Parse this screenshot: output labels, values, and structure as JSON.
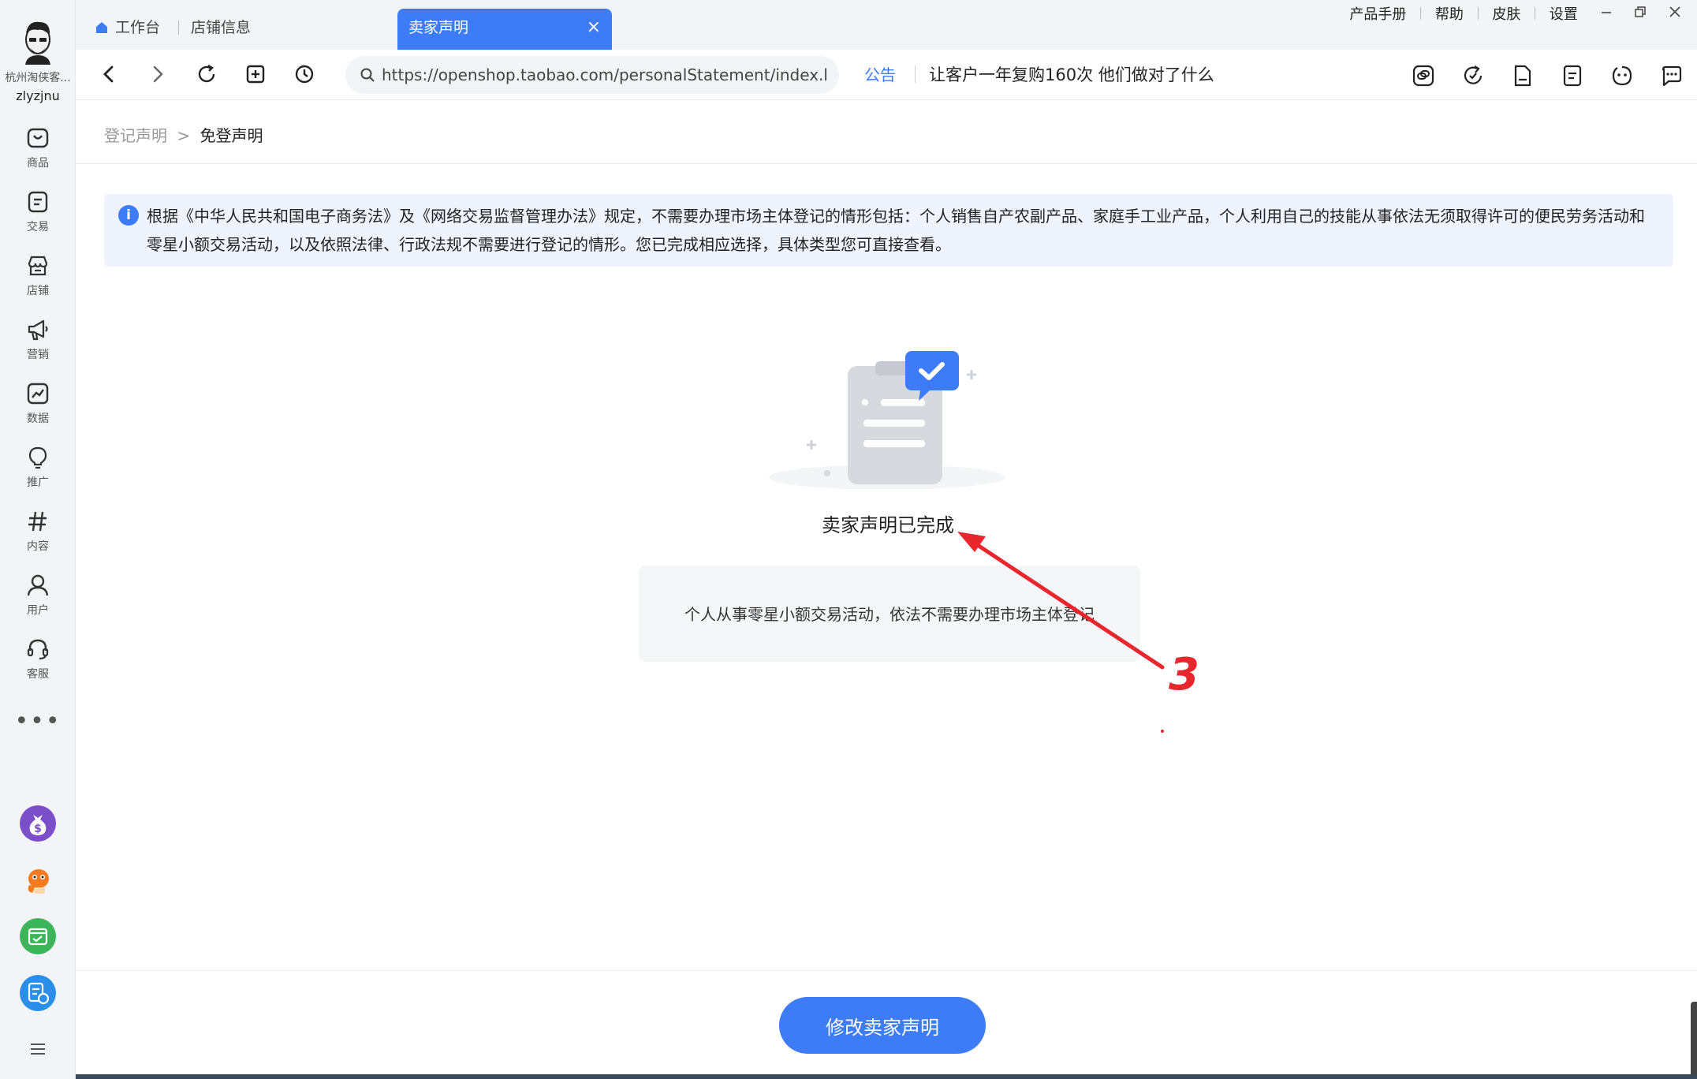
{
  "sidebar": {
    "shop_name": "杭州淘侠客...",
    "user_name": "zlyzjnu",
    "items": [
      {
        "label": "商品",
        "icon": "bag-icon"
      },
      {
        "label": "交易",
        "icon": "order-icon"
      },
      {
        "label": "店铺",
        "icon": "store-icon"
      },
      {
        "label": "营销",
        "icon": "megaphone-icon"
      },
      {
        "label": "数据",
        "icon": "chart-icon"
      },
      {
        "label": "推广",
        "icon": "bulb-icon"
      },
      {
        "label": "内容",
        "icon": "hashtag-icon"
      },
      {
        "label": "用户",
        "icon": "user-icon"
      },
      {
        "label": "客服",
        "icon": "headset-icon"
      }
    ],
    "more": "•••",
    "apps": [
      "money-bag-icon",
      "mascot-icon",
      "calendar-icon",
      "report-icon"
    ],
    "menu_icon": "hamburger-icon"
  },
  "tabs": {
    "home": "工作台",
    "shop_info": "店铺信息",
    "active": "卖家声明",
    "close": "×"
  },
  "top_links": {
    "manual": "产品手册",
    "help": "帮助",
    "skin": "皮肤",
    "settings": "设置"
  },
  "address_bar": {
    "url": "https://openshop.taobao.com/personalStatement/index.htm?sp",
    "notice_tag": "公告",
    "notice_text": "让客户一年复购160次 他们做对了什么"
  },
  "breadcrumb": {
    "parent": "登记声明",
    "arrow": ">",
    "current": "免登声明"
  },
  "info": {
    "icon": "i",
    "text": "根据《中华人民共和国电子商务法》及《网络交易监督管理办法》规定，不需要办理市场主体登记的情形包括：个人销售自产农副产品、家庭手工业产品，个人利用自己的技能从事依法无须取得许可的便民劳务活动和零星小额交易活动，以及依照法律、行政法规不需要进行登记的情形。您已完成相应选择，具体类型您可直接查看。"
  },
  "result": {
    "title": "卖家声明已完成",
    "detail": "个人从事零星小额交易活动，依法不需要办理市场主体登记"
  },
  "annotation": {
    "number": "3",
    "color": "#e8262d"
  },
  "actions": {
    "modify": "修改卖家声明"
  },
  "colors": {
    "accent": "#3d7bf7",
    "sidebar_bg": "#f2f4f7",
    "info_bg": "#eef3fd"
  }
}
